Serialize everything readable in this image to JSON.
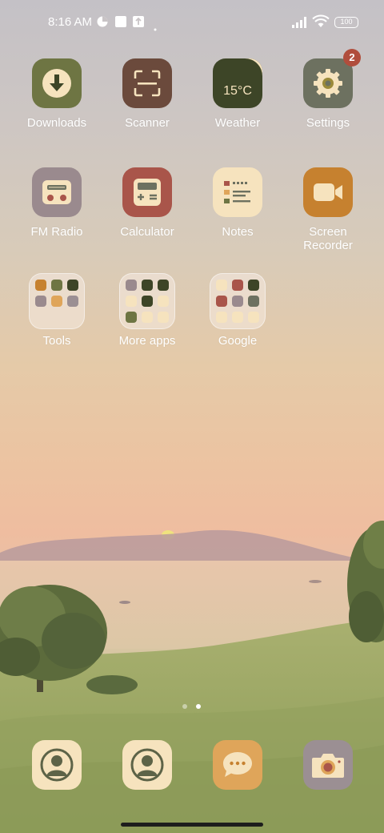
{
  "status_bar": {
    "time": "8:16 AM",
    "battery_level": "100"
  },
  "colors": {
    "olive": "#6e7543",
    "brown": "#6b4a3c",
    "dark_olive": "#3d4527",
    "grey_green": "#6d7160",
    "mauve": "#9a8a8e",
    "red": "#a9554a",
    "cream": "#f6e3be",
    "orange": "#c6812f",
    "dusty_mauve": "#9b8f93",
    "dock_orange": "#dfa55a",
    "badge": "#b04d3c"
  },
  "apps": [
    {
      "label": "Downloads",
      "icon": "download-icon"
    },
    {
      "label": "Scanner",
      "icon": "scan-icon"
    },
    {
      "label": "Weather",
      "icon": "weather-icon",
      "temperature": "15°C"
    },
    {
      "label": "Settings",
      "icon": "gear-icon",
      "badge": "2"
    },
    {
      "label": "FM Radio",
      "icon": "radio-icon"
    },
    {
      "label": "Calculator",
      "icon": "calculator-icon"
    },
    {
      "label": "Notes",
      "icon": "notes-icon"
    },
    {
      "label": "Screen Recorder",
      "label_line1": "Screen",
      "label_line2": "Recorder",
      "icon": "video-camera-icon"
    }
  ],
  "folders": [
    {
      "label": "Tools"
    },
    {
      "label": "More apps"
    },
    {
      "label": "Google"
    }
  ],
  "dock": [
    {
      "name": "contacts",
      "icon": "person-icon"
    },
    {
      "name": "contacts-2",
      "icon": "person-icon"
    },
    {
      "name": "messages",
      "icon": "chat-bubble-icon"
    },
    {
      "name": "camera",
      "icon": "camera-icon"
    }
  ],
  "page_indicator": {
    "pages": 2,
    "current": 2
  }
}
